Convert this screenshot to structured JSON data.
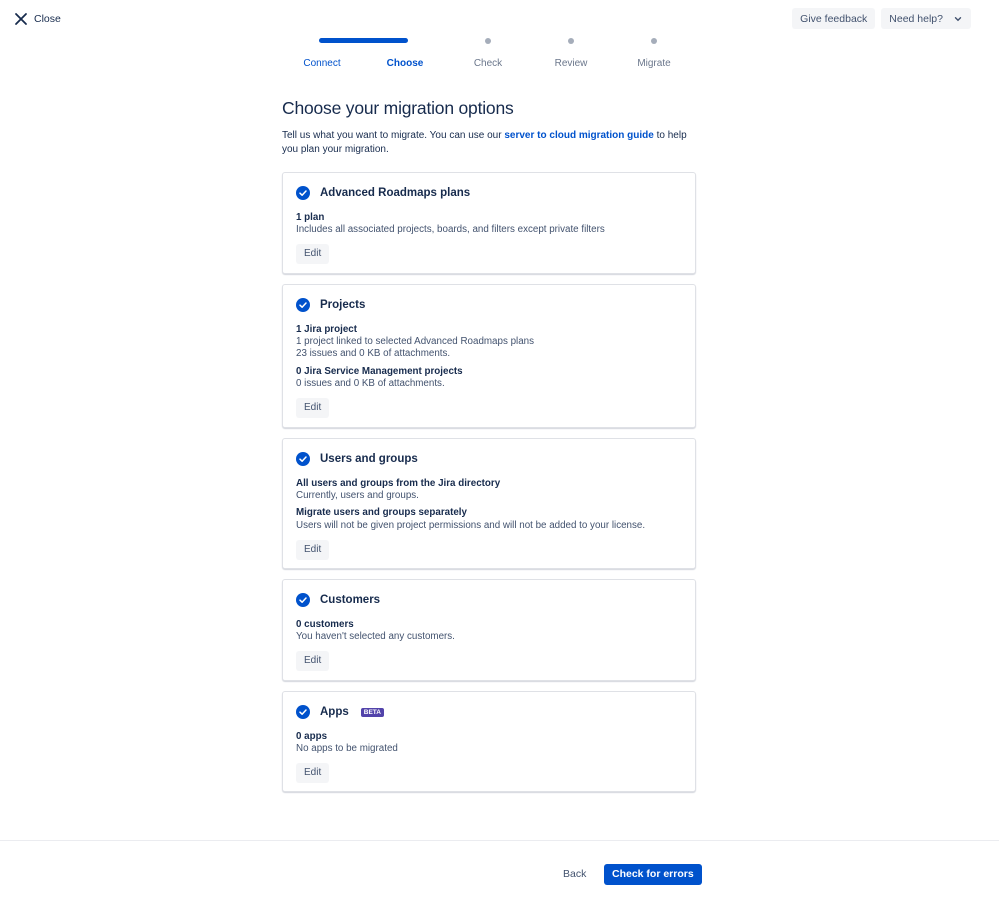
{
  "header": {
    "close_label": "Close",
    "feedback_label": "Give feedback",
    "help_label": "Need help?"
  },
  "stepper": {
    "steps": [
      {
        "label": "Connect",
        "state": "done"
      },
      {
        "label": "Choose",
        "state": "current"
      },
      {
        "label": "Check",
        "state": "todo"
      },
      {
        "label": "Review",
        "state": "todo"
      },
      {
        "label": "Migrate",
        "state": "todo"
      }
    ]
  },
  "main": {
    "title": "Choose your migration options",
    "intro_before": "Tell us what you want to migrate. You can use our ",
    "intro_link": "server to cloud migration guide",
    "intro_after": " to help you plan your migration."
  },
  "cards": [
    {
      "title": "Advanced Roadmaps plans",
      "lines": [
        {
          "b": "1 plan"
        },
        {
          "t": "Includes all associated projects, boards, and filters except private filters"
        }
      ],
      "edit": "Edit"
    },
    {
      "title": "Projects",
      "lines": [
        {
          "b": "1 Jira project"
        },
        {
          "t": "1 project linked to selected Advanced Roadmaps plans"
        },
        {
          "t": "23 issues and 0 KB of attachments."
        },
        {
          "b": "0 Jira Service Management projects"
        },
        {
          "t": "0 issues and 0 KB of attachments."
        }
      ],
      "edit": "Edit"
    },
    {
      "title": "Users and groups",
      "lines": [
        {
          "b": "All users and groups from the Jira directory"
        },
        {
          "t": "Currently, users and groups."
        },
        {
          "b": "Migrate users and groups separately"
        },
        {
          "t": "Users will not be given project permissions and will not be added to your license."
        }
      ],
      "edit": "Edit"
    },
    {
      "title": "Customers",
      "lines": [
        {
          "b": "0 customers"
        },
        {
          "t": "You haven't selected any customers."
        }
      ],
      "edit": "Edit"
    },
    {
      "title": "Apps",
      "badge": "BETA",
      "lines": [
        {
          "b": "0 apps"
        },
        {
          "t": "No apps to be migrated"
        }
      ],
      "edit": "Edit"
    }
  ],
  "footer": {
    "back_label": "Back",
    "primary_label": "Check for errors"
  },
  "colors": {
    "brand": "#0052cc",
    "text": "#172b4d",
    "subtle": "#42526e",
    "beta": "#5243aa"
  }
}
